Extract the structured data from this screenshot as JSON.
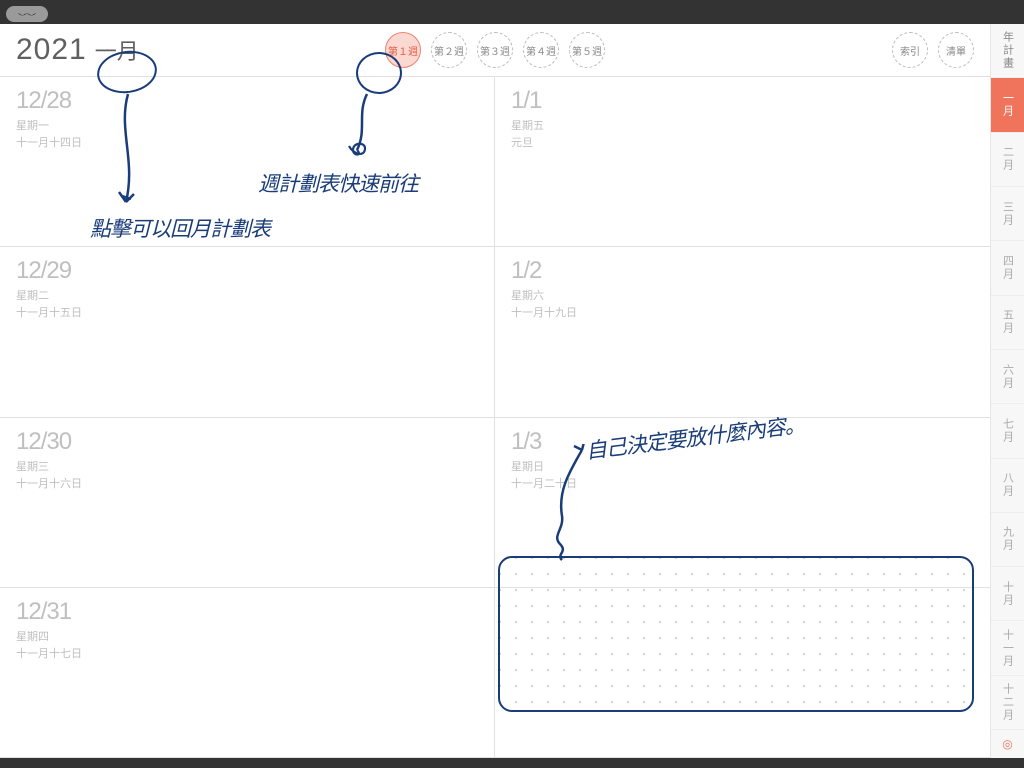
{
  "header": {
    "year": "2021",
    "month": "一月"
  },
  "weeks": [
    {
      "label": "第１週",
      "active": true
    },
    {
      "label": "第２週",
      "active": false
    },
    {
      "label": "第３週",
      "active": false
    },
    {
      "label": "第４週",
      "active": false
    },
    {
      "label": "第５週",
      "active": false
    }
  ],
  "right_buttons": [
    {
      "label": "索引"
    },
    {
      "label": "清單"
    }
  ],
  "days": [
    {
      "date": "12/28",
      "weekday": "星期一",
      "lunar": "十一月十四日"
    },
    {
      "date": "1/1",
      "weekday": "星期五",
      "lunar": "元旦"
    },
    {
      "date": "12/29",
      "weekday": "星期二",
      "lunar": "十一月十五日"
    },
    {
      "date": "1/2",
      "weekday": "星期六",
      "lunar": "十一月十九日"
    },
    {
      "date": "12/30",
      "weekday": "星期三",
      "lunar": "十一月十六日"
    },
    {
      "date": "1/3",
      "weekday": "星期日",
      "lunar": "十一月二十日"
    },
    {
      "date": "12/31",
      "weekday": "星期四",
      "lunar": "十一月十七日"
    }
  ],
  "sidebar": {
    "plan": "年計畫",
    "months": [
      {
        "label": "一月",
        "active": true
      },
      {
        "label": "二月"
      },
      {
        "label": "三月"
      },
      {
        "label": "四月"
      },
      {
        "label": "五月"
      },
      {
        "label": "六月"
      },
      {
        "label": "七月"
      },
      {
        "label": "八月"
      },
      {
        "label": "九月"
      },
      {
        "label": "十月"
      },
      {
        "label": "十一月"
      },
      {
        "label": "十二月"
      }
    ]
  },
  "annotations": {
    "month_tip": "點擊可以回月計劃表",
    "week_tip": "週計劃表快速前往",
    "content_tip": "自己決定要放什麼內容。"
  }
}
